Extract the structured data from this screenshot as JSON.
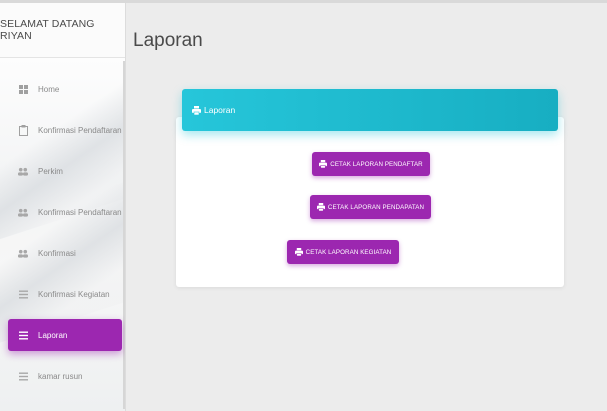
{
  "sidebar": {
    "brand": "SELAMAT DATANG RIYAN",
    "items": [
      {
        "label": "Home",
        "icon": "grid-icon"
      },
      {
        "label": "Konfirmasi Pendaftaran",
        "icon": "clipboard-icon"
      },
      {
        "label": "Perkim",
        "icon": "people-icon"
      },
      {
        "label": "Konfirmasi Pendaftaran",
        "icon": "people-icon"
      },
      {
        "label": "Konfirmasi",
        "icon": "people-icon"
      },
      {
        "label": "Konfirmasi Kegiatan",
        "icon": "list-icon"
      },
      {
        "label": "Laporan",
        "icon": "list-icon",
        "active": true
      },
      {
        "label": "kamar rusun",
        "icon": "list-icon"
      }
    ]
  },
  "main": {
    "title": "Laporan",
    "card": {
      "header": "Laporan",
      "buttons": [
        "CETAK LAPORAN PENDAFTAR",
        "CETAK LAPORAN PENDAPATAN",
        "CETAK LAPORAN KEGIATAN"
      ]
    }
  },
  "colors": {
    "accent": "#9c27b0",
    "header": "#26c6da",
    "background": "#ececec"
  }
}
